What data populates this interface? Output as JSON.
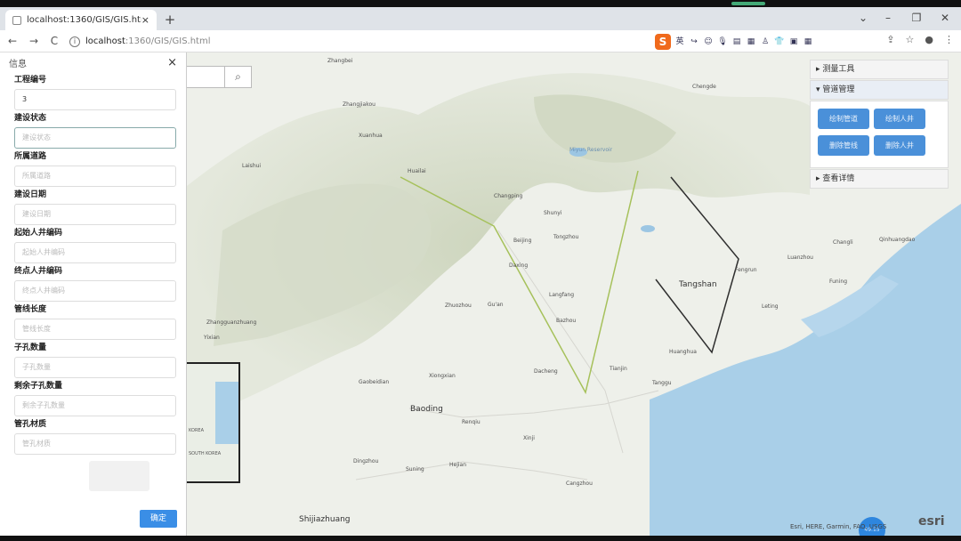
{
  "browser": {
    "tab_title": "localhost:1360/GIS/GIS.html",
    "tab_close": "×",
    "new_tab": "+",
    "favicon": "page-icon",
    "nav_back": "←",
    "nav_forward": "→",
    "nav_reload": "C",
    "url_host": "localhost",
    "url_rest": ":1360/GIS/GIS.html",
    "extensions": [
      "S",
      "英",
      "↪",
      "☺",
      "🎙",
      "▤",
      "▦",
      "♙",
      "👕",
      "▣",
      "▦"
    ],
    "window_controls": {
      "minimize": "–",
      "restore": "❐",
      "close": "✕",
      "menu": "⌄"
    },
    "right_icons": [
      "⇪",
      "☆",
      "●",
      "⋮"
    ]
  },
  "panel": {
    "title": "信息",
    "close": "×",
    "fields": [
      {
        "label": "工程编号",
        "value": "3",
        "placeholder": ""
      },
      {
        "label": "建设状态",
        "value": "",
        "placeholder": "建设状态"
      },
      {
        "label": "所属道路",
        "value": "",
        "placeholder": "所属道路"
      },
      {
        "label": "建设日期",
        "value": "",
        "placeholder": "建设日期"
      },
      {
        "label": "起始人井编码",
        "value": "",
        "placeholder": "起始人井编码"
      },
      {
        "label": "终点人井编码",
        "value": "",
        "placeholder": "终点人井编码"
      },
      {
        "label": "管线长度",
        "value": "",
        "placeholder": "管线长度"
      },
      {
        "label": "子孔数量",
        "value": "",
        "placeholder": "子孔数量"
      },
      {
        "label": "剩余子孔数量",
        "value": "",
        "placeholder": "剩余子孔数量"
      },
      {
        "label": "管孔材质",
        "value": "",
        "placeholder": "管孔材质"
      }
    ],
    "ok_label": "确定"
  },
  "map": {
    "search_icon": "search-icon",
    "cities": [
      {
        "name": "Zhangbei",
        "big": false
      },
      {
        "name": "Zhangjiakou",
        "big": false
      },
      {
        "name": "Xuanhua",
        "big": false
      },
      {
        "name": "Huailai",
        "big": false
      },
      {
        "name": "Changping",
        "big": false
      },
      {
        "name": "Shunyi",
        "big": false
      },
      {
        "name": "Beijing",
        "big": false
      },
      {
        "name": "Tongzhou",
        "big": false
      },
      {
        "name": "Daxing",
        "big": false
      },
      {
        "name": "Langfang",
        "big": false
      },
      {
        "name": "Zhuozhou",
        "big": false
      },
      {
        "name": "Gu'an",
        "big": false
      },
      {
        "name": "Bazhou",
        "big": false
      },
      {
        "name": "Tianjin",
        "big": false
      },
      {
        "name": "Tanggu",
        "big": false
      },
      {
        "name": "Tangshan",
        "big": true
      },
      {
        "name": "Fengrun",
        "big": false
      },
      {
        "name": "Chengde",
        "big": false
      },
      {
        "name": "Qinhuangdao",
        "big": false
      },
      {
        "name": "Luanzhou",
        "big": false
      },
      {
        "name": "Leting",
        "big": false
      },
      {
        "name": "Baoding",
        "big": true
      },
      {
        "name": "Renqiu",
        "big": false
      },
      {
        "name": "Hejian",
        "big": false
      },
      {
        "name": "Cangzhou",
        "big": false
      },
      {
        "name": "Dingzhou",
        "big": false
      },
      {
        "name": "Shijiazhuang",
        "big": true
      },
      {
        "name": "Yixian",
        "big": false
      },
      {
        "name": "Laishui",
        "big": false
      },
      {
        "name": "Zhangguanzhuang",
        "big": false
      },
      {
        "name": "Gaobeidian",
        "big": false
      },
      {
        "name": "Xiongxian",
        "big": false
      },
      {
        "name": "Dacheng",
        "big": false
      },
      {
        "name": "Huanghua",
        "big": false
      },
      {
        "name": "Changli",
        "big": false
      },
      {
        "name": "Funing",
        "big": false
      },
      {
        "name": "Suning",
        "big": false
      },
      {
        "name": "Xinji",
        "big": false
      },
      {
        "name": "Miyun Reservoir",
        "big": false
      }
    ],
    "inset_labels": [
      "KOREA",
      "SOUTH KOREA"
    ],
    "attribution": "Esri, HERE, Garmin, FAO, USGS",
    "esri_logo": "esri",
    "bubble_label": "49.15"
  },
  "tools": {
    "sections": [
      {
        "label": "测量工具",
        "arrow": "▸"
      },
      {
        "label": "管道管理",
        "arrow": "▾"
      },
      {
        "label": "查看详情",
        "arrow": "▸"
      }
    ],
    "buttons": [
      "绘制管道",
      "绘制人井",
      "删除管线",
      "删除人井"
    ]
  },
  "colors": {
    "button_blue": "#4a90d9",
    "ok_blue": "#3a8ee6",
    "route_green": "#a6c15b",
    "route_dark": "#2f2f2f",
    "sea": "#a9cfe8"
  }
}
